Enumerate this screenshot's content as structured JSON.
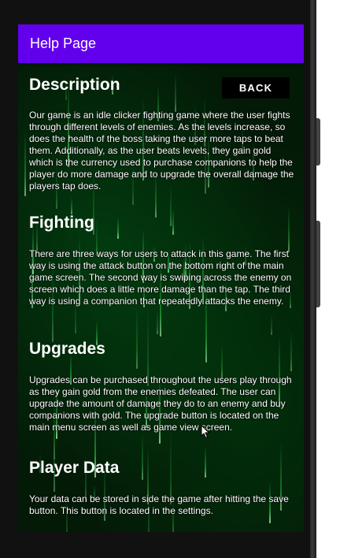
{
  "appbar": {
    "title": "Help Page"
  },
  "back_button": {
    "label": "BACK"
  },
  "sections": [
    {
      "title": "Description",
      "body": "Our game is an idle clicker fighting game where the user fights through different levels of enemies. As the levels increase, so does the health of the boss taking the user more taps to beat them. Additionally, as the user beats levels, they gain gold which is the currency used to purchase companions to help the player do more damage and to upgrade the overall damage the players tap does."
    },
    {
      "title": "Fighting",
      "body": "There are three ways for users to attack in this game. The first way is using the attack button on the bottom right of the main game screen. The second way is swiping across the enemy on screen which does a little more damage than the tap. The third way is using a companion that repeatedly attacks the enemy."
    },
    {
      "title": "Upgrades",
      "body": "Upgrades can be purchased throughout the users play through as they gain gold from the enemies defeated. The user can upgrade the amount of damage they do to an enemy and buy companions with gold. The upgrade button is located on the main menu screen as well as game view screen."
    },
    {
      "title": "Player Data",
      "body": "Your data can be stored in side the game after hitting the save button. This button is located in the settings."
    }
  ],
  "colors": {
    "appbar": "#6200ee",
    "background": "#031a07",
    "rain": "#3cff5a"
  },
  "icons": {
    "cursor": "mouse-pointer-icon"
  }
}
